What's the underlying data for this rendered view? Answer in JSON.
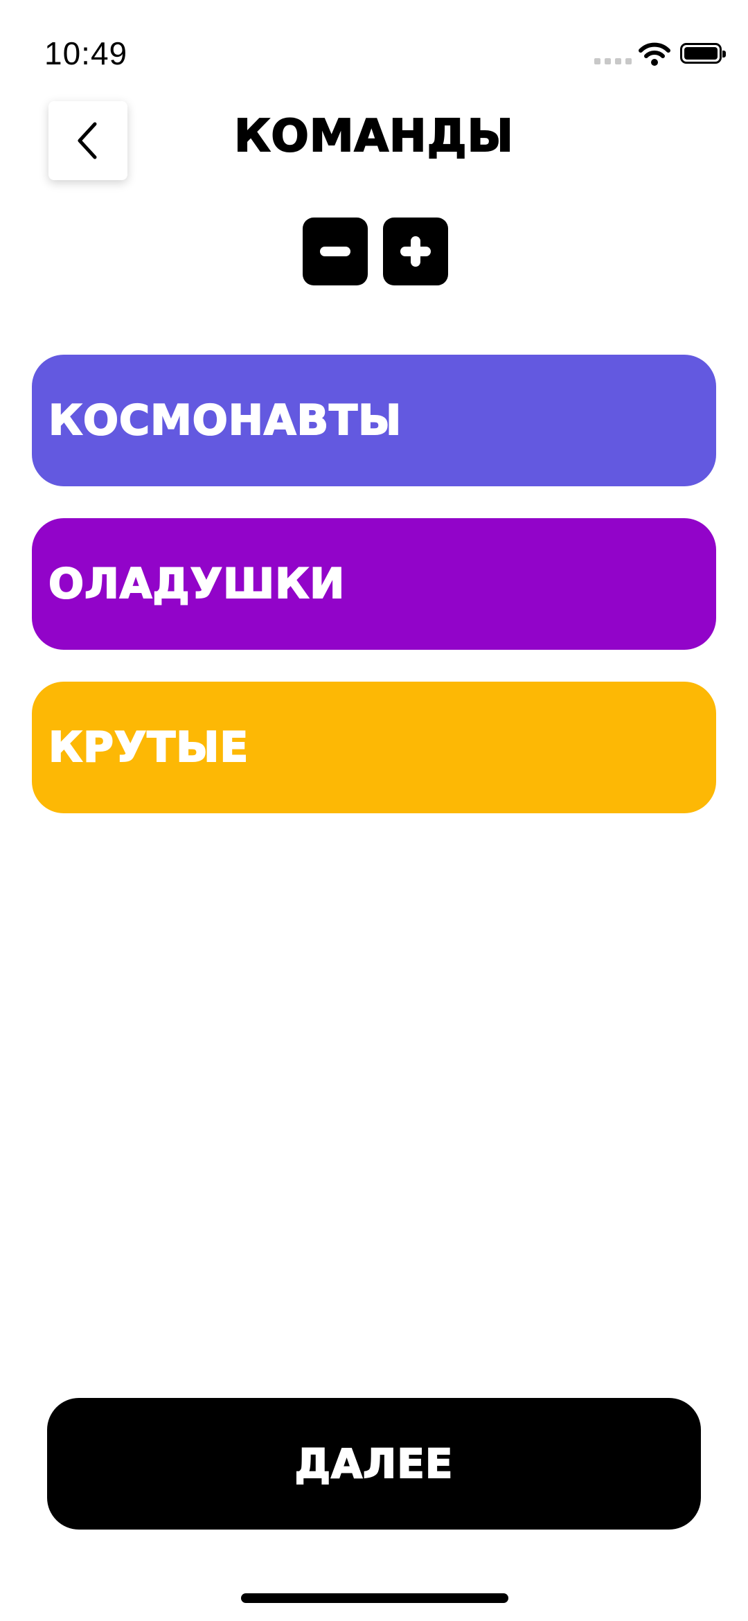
{
  "status_bar": {
    "time": "10:49",
    "icons": [
      "cellular-signal-icon",
      "wifi-icon",
      "battery-icon"
    ]
  },
  "header": {
    "back_icon": "chevron-left-icon",
    "title": "КОМАНДЫ"
  },
  "stepper": {
    "decrease_icon": "minus-icon",
    "increase_icon": "plus-icon"
  },
  "teams": [
    {
      "name": "КОСМОНАВТЫ",
      "color": "#6359E0"
    },
    {
      "name": "ОЛАДУШКИ",
      "color": "#9204C9"
    },
    {
      "name": "КРУТЫЕ",
      "color": "#FDB805"
    }
  ],
  "footer": {
    "next_label": "ДАЛЕЕ"
  },
  "colors": {
    "background": "#FFFFFF",
    "primary": "#000000"
  }
}
